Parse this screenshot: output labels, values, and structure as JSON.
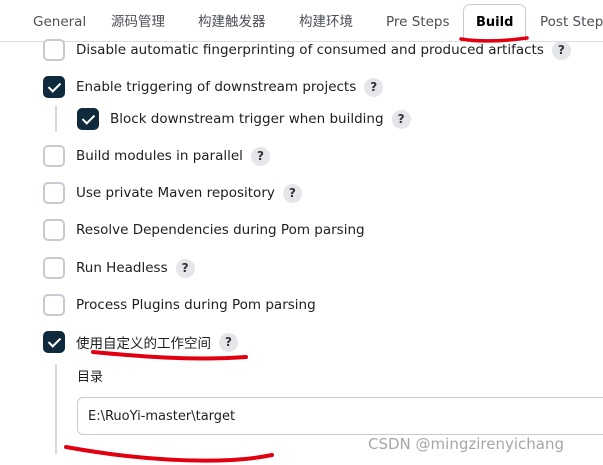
{
  "tabs": [
    {
      "label": "General"
    },
    {
      "label": "源码管理"
    },
    {
      "label": "构建触发器"
    },
    {
      "label": "构建环境"
    },
    {
      "label": "Pre Steps"
    },
    {
      "label": "Build",
      "active": true
    },
    {
      "label": "Post Steps"
    }
  ],
  "options": [
    {
      "label": "Disable automatic fingerprinting of consumed and produced artifacts",
      "checked": false,
      "help": "?"
    },
    {
      "label": "Enable triggering of downstream projects",
      "checked": true,
      "help": "?"
    },
    {
      "label": "Block downstream trigger when building",
      "checked": true,
      "help": "?"
    },
    {
      "label": "Build modules in parallel",
      "checked": false,
      "help": "?"
    },
    {
      "label": "Use private Maven repository",
      "checked": false,
      "help": "?"
    },
    {
      "label": "Resolve Dependencies during Pom parsing",
      "checked": false
    },
    {
      "label": "Run Headless",
      "checked": false,
      "help": "?"
    },
    {
      "label": "Process Plugins during Pom parsing",
      "checked": false
    },
    {
      "label": "使用自定义的工作空间",
      "checked": true,
      "help": "?"
    }
  ],
  "workspace": {
    "directory_label": "目录",
    "directory_value": "E:\\RuoYi-master\\target"
  },
  "watermark": "CSDN @mingzirenyichang",
  "colors": {
    "checked": "#0f2a3d",
    "annotation": "#e0000f"
  }
}
